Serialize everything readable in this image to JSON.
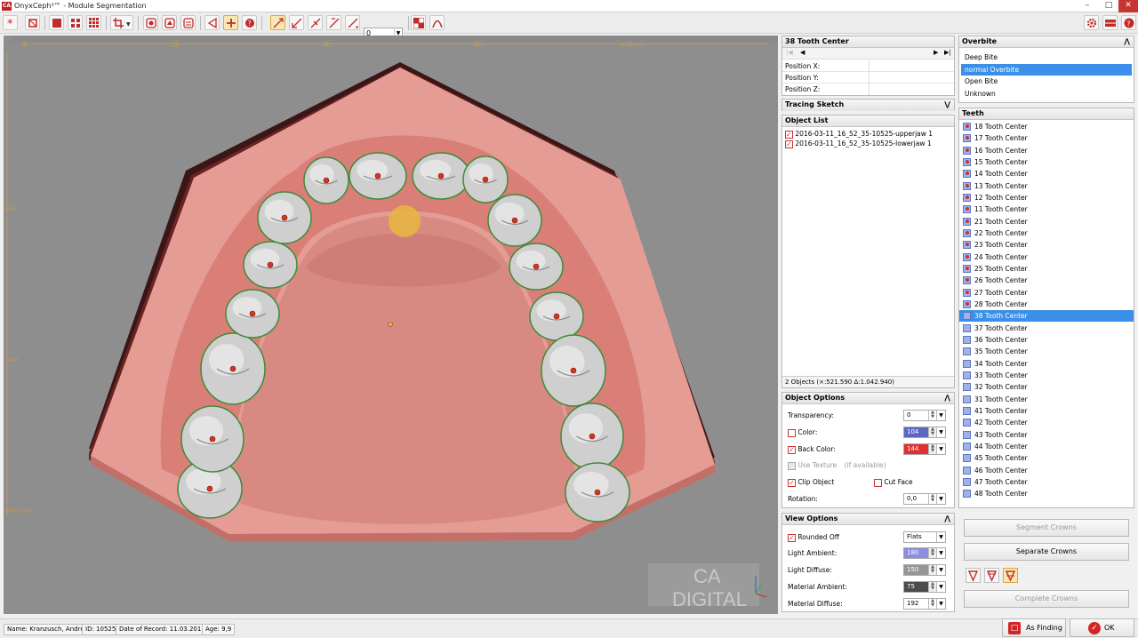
{
  "app": {
    "title": "OnyxCeph³™ - Module Segmentation",
    "logo": "CA"
  },
  "toolbar": {
    "spin_value": "0"
  },
  "viewport": {
    "ruler_top": [
      "0",
      "20",
      "40",
      "60",
      "80 mm"
    ],
    "ruler_left": [
      "20",
      "40",
      "60 mm"
    ],
    "watermark_line1": "CA",
    "watermark_line2": "DIGITAL"
  },
  "tooth_center": {
    "title": "38 Tooth Center",
    "rows": [
      {
        "label": "Position X:",
        "value": ""
      },
      {
        "label": "Position Y:",
        "value": ""
      },
      {
        "label": "Position Z:",
        "value": ""
      }
    ]
  },
  "tracing": {
    "title": "Tracing Sketch"
  },
  "object_list": {
    "title": "Object List",
    "items": [
      "2016-03-11_16_52_35-10525-upperjaw 1",
      "2016-03-11_16_52_35-10525-lowerjaw 1"
    ],
    "footer": "2 Objects (×:521.590 Δ:1.042.940)"
  },
  "object_options": {
    "title": "Object Options",
    "transparency_label": "Transparency:",
    "transparency_value": "0",
    "color_label": "Color:",
    "color_value": "104",
    "back_color_label": "Back Color:",
    "back_color_value": "144",
    "use_texture_label": "Use Texture",
    "use_texture_hint": "(if available)",
    "clip_object_label": "Clip Object",
    "cut_face_label": "Cut Face",
    "rotation_label": "Rotation:",
    "rotation_value": "0,0"
  },
  "view_options": {
    "title": "View Options",
    "rounded_off_label": "Rounded Off",
    "shading_value": "Flats",
    "light_ambient_label": "Light Ambient:",
    "light_ambient_value": "180",
    "light_diffuse_label": "Light Diffuse:",
    "light_diffuse_value": "150",
    "material_ambient_label": "Material Ambient:",
    "material_ambient_value": "75",
    "material_diffuse_label": "Material Diffuse:",
    "material_diffuse_value": "192"
  },
  "overbite": {
    "title": "Overbite",
    "options": [
      "Deep Bite",
      "normal Overbite",
      "Open Bite",
      "Unknown"
    ],
    "selected": 1
  },
  "teeth": {
    "title": "Teeth",
    "items": [
      "18 Tooth Center",
      "17 Tooth Center",
      "16 Tooth Center",
      "15 Tooth Center",
      "14 Tooth Center",
      "13 Tooth Center",
      "12 Tooth Center",
      "11 Tooth Center",
      "21 Tooth Center",
      "22 Tooth Center",
      "23 Tooth Center",
      "24 Tooth Center",
      "25 Tooth Center",
      "26 Tooth Center",
      "27 Tooth Center",
      "28 Tooth Center",
      "38 Tooth Center",
      "37 Tooth Center",
      "36 Tooth Center",
      "35 Tooth Center",
      "34 Tooth Center",
      "33 Tooth Center",
      "32 Tooth Center",
      "31 Tooth Center",
      "41 Tooth Center",
      "42 Tooth Center",
      "43 Tooth Center",
      "44 Tooth Center",
      "45 Tooth Center",
      "46 Tooth Center",
      "47 Tooth Center",
      "48 Tooth Center"
    ],
    "set_count": 16,
    "selected_index": 16
  },
  "actions": {
    "segment_crowns": "Segment Crowns",
    "separate_crowns": "Separate Crowns",
    "complete_crowns": "Complete Crowns"
  },
  "status": {
    "name": "Name: Kranzusch, André",
    "id": "ID: 10525",
    "date": "Date of Record: 11.03.2016",
    "age": "Age: 9,9"
  },
  "footer": {
    "as_finding": "As Finding",
    "ok": "OK"
  },
  "colors": {
    "accent": "#c32a2a",
    "selection": "#3b8fe8",
    "gum": "#d97f77",
    "tooth": "#cfcfcf"
  }
}
